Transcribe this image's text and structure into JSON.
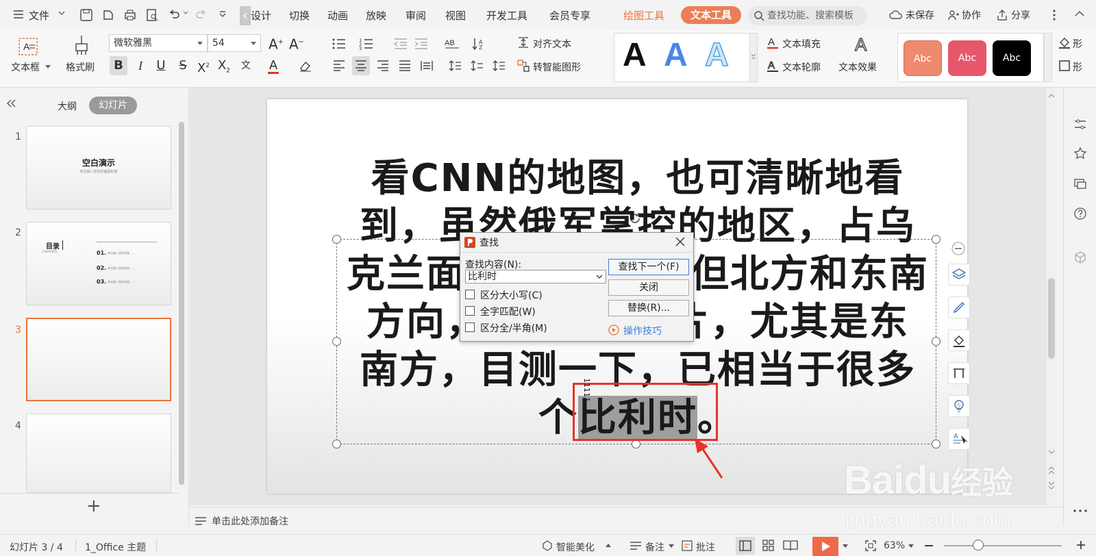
{
  "menubar": {
    "file_label": "文件",
    "tabs": [
      "设计",
      "切换",
      "动画",
      "放映",
      "审阅",
      "视图",
      "开发工具",
      "会员专享"
    ],
    "drawing_tools": "绘图工具",
    "text_tools": "文本工具",
    "search_placeholder": "查找功能、搜索模板",
    "unsaved": "未保存",
    "collaborate": "协作",
    "share": "分享"
  },
  "ribbon": {
    "textbox": "文本框",
    "format_painter": "格式刷",
    "font_name": "微软雅黑",
    "font_size": "54",
    "align_text": "对齐文本",
    "smart_shape": "转智能图形",
    "text_fill": "文本填充",
    "text_outline": "文本轮廓",
    "text_effect": "文本效果",
    "shape_fill_partial": "形",
    "shape_outline_partial": "形",
    "abc1": "Abc",
    "abc2": "Abc",
    "abc3": "Abc",
    "bigA": "A"
  },
  "leftpanel": {
    "outline_tab": "大纲",
    "slides_tab": "幻灯片",
    "add_symbol": "+",
    "slides": [
      {
        "num": "1",
        "title": "空白演示",
        "subtitle": "单击输入您的封面副标题"
      },
      {
        "num": "2",
        "title": "目录",
        "sub": "CONTENTS",
        "items": [
          "01.",
          "02.",
          "03."
        ],
        "item_text": "单击输入您的标题……"
      },
      {
        "num": "3"
      },
      {
        "num": "4"
      }
    ]
  },
  "slide": {
    "text_before": "看CNN的地图，也可清晰地看到，虽然俄军掌控的地区，占乌克兰面积不大，但北方和东南方向，占去一大片，尤其是东南方，目测一下，已相当于很多个",
    "line1": "看CNN的地图，也可清晰地看",
    "line2": "到，虽然俄军掌控的地区，占乌",
    "line3a": "克兰面",
    "line3b": "但北方和东南",
    "line4a": "方向，",
    "line4b": "片，尤其是东",
    "line5": "南方，目测一下，已相当于很多",
    "line6_prefix": "个",
    "highlight": "比利时",
    "line6_suffix": "。",
    "vertical_label": "11111"
  },
  "find_dialog": {
    "title": "查找",
    "find_label": "查找内容(N):",
    "find_value": "比利时",
    "opt_case": "区分大小写(C)",
    "opt_whole": "全字匹配(W)",
    "opt_width": "区分全/半角(M)",
    "btn_find_next": "查找下一个(F)",
    "btn_close": "关闭",
    "btn_replace": "替换(R)...",
    "tips": "操作技巧"
  },
  "notes": {
    "placeholder": "单击此处添加备注"
  },
  "statusbar": {
    "slide_count": "幻灯片 3 / 4",
    "theme": "1_Office 主题",
    "beautify": "智能美化",
    "notes": "备注",
    "comments": "批注",
    "zoom": "63%"
  },
  "watermark": {
    "brand": "Baidu",
    "brand_cn": "经验",
    "url": "jingyan.baidu.com"
  },
  "colors": {
    "accent": "#e8743b",
    "highlight_box": "#e8322a",
    "abc1": "#ee8a6e",
    "abc2": "#e8566b",
    "abc3": "#000000"
  }
}
